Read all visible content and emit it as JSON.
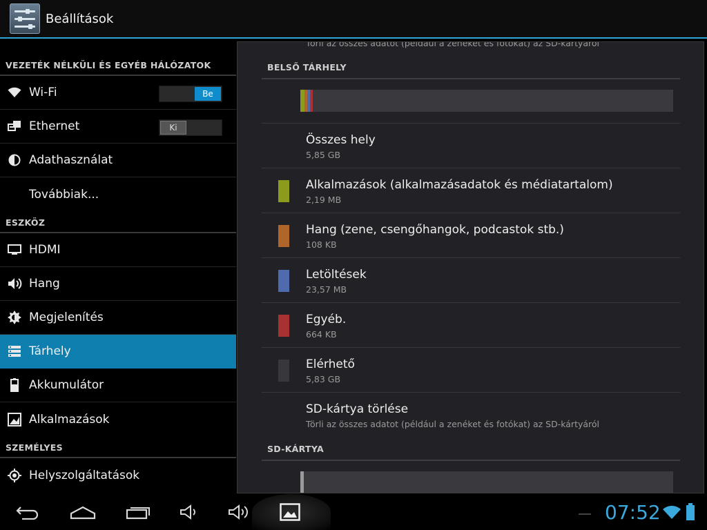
{
  "app": {
    "title": "Beállítások",
    "icon": "settings-sliders-icon"
  },
  "sidebar": {
    "sections": [
      {
        "title": "VEZETÉK NÉLKÜLI ÉS EGYÉB HÁLÓZATOK"
      },
      {
        "title": "ESZKÖZ"
      },
      {
        "title": "SZEMÉLYES"
      }
    ],
    "items": [
      {
        "label": "Wi-Fi",
        "icon": "wifi-icon",
        "toggle": "Be"
      },
      {
        "label": "Ethernet",
        "icon": "ethernet-icon",
        "toggle": "Ki"
      },
      {
        "label": "Adathasználat",
        "icon": "data-usage-icon"
      },
      {
        "label": "Továbbiak...",
        "icon": ""
      },
      {
        "label": "HDMI",
        "icon": "monitor-icon"
      },
      {
        "label": "Hang",
        "icon": "speaker-icon"
      },
      {
        "label": "Megjelenítés",
        "icon": "brightness-icon"
      },
      {
        "label": "Tárhely",
        "icon": "storage-icon",
        "selected": true
      },
      {
        "label": "Akkumulátor",
        "icon": "battery-icon"
      },
      {
        "label": "Alkalmazások",
        "icon": "apps-icon"
      },
      {
        "label": "Helyszolgáltatások",
        "icon": "location-icon"
      }
    ]
  },
  "main": {
    "cut_text": "Törli az összes adatot (például a zenéket és fotókat) az SD-kártyáról",
    "internal": {
      "title": "BELSŐ TÁRHELY",
      "bar_segments": [
        {
          "color": "#8c9a1e",
          "fraction": 0.011
        },
        {
          "color": "#b0652a",
          "fraction": 0.006
        },
        {
          "color": "#4f6aad",
          "fraction": 0.008
        },
        {
          "color": "#a83232",
          "fraction": 0.007
        }
      ],
      "rows": [
        {
          "title": "Összes hely",
          "sub": "5,85 GB",
          "color": ""
        },
        {
          "title": "Alkalmazások (alkalmazásadatok és médiatartalom)",
          "sub": "2,19 MB",
          "color": "#8c9a1e"
        },
        {
          "title": "Hang (zene, csengőhangok, podcastok stb.)",
          "sub": "108 KB",
          "color": "#b0652a"
        },
        {
          "title": "Letöltések",
          "sub": "23,57 MB",
          "color": "#4f6aad"
        },
        {
          "title": "Egyéb.",
          "sub": "664 KB",
          "color": "#a83232"
        },
        {
          "title": "Elérhető",
          "sub": "5,83 GB",
          "color": "#38383c"
        },
        {
          "title": "SD-kártya törlése",
          "sub": "Törli az összes adatot (például a zenéket és fotókat) az SD-kártyáról",
          "color": ""
        }
      ]
    },
    "sdcard": {
      "title": "SD-KÁRTYA",
      "bar_segments": [
        {
          "color": "#9a9a9a",
          "fraction": 0.01
        }
      ]
    }
  },
  "navbar": {
    "clock": "07:52",
    "buttons": [
      "back-icon",
      "home-icon",
      "recent-apps-icon",
      "volume-down-icon",
      "volume-up-icon",
      "screenshot-icon"
    ],
    "status": [
      "wifi-icon",
      "battery-icon"
    ]
  }
}
